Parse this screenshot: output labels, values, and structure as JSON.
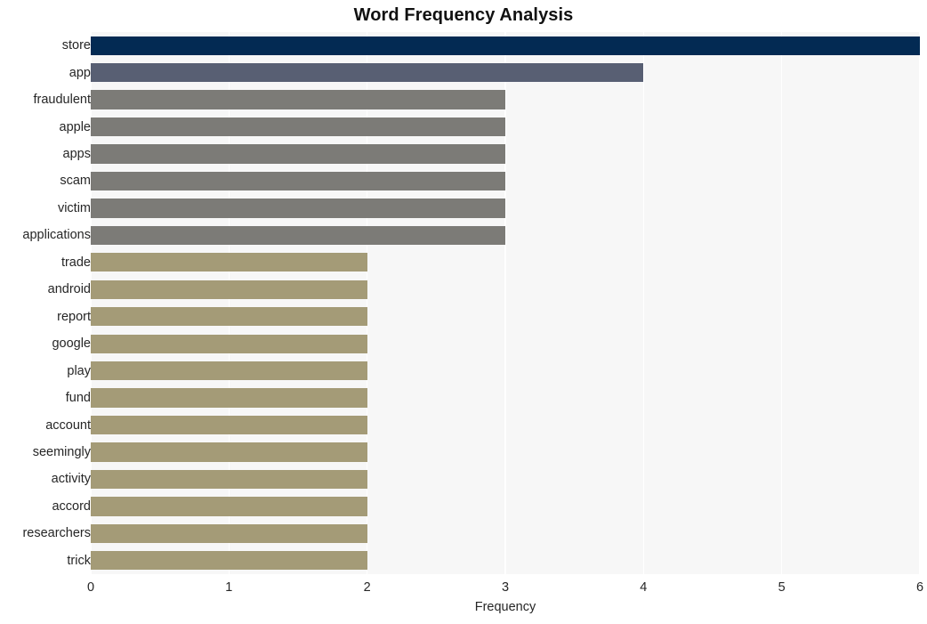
{
  "chart_data": {
    "type": "bar",
    "orientation": "horizontal",
    "title": "Word Frequency Analysis",
    "xlabel": "Frequency",
    "ylabel": "",
    "categories": [
      "store",
      "app",
      "fraudulent",
      "apple",
      "apps",
      "scam",
      "victim",
      "applications",
      "trade",
      "android",
      "report",
      "google",
      "play",
      "fund",
      "account",
      "seemingly",
      "activity",
      "accord",
      "researchers",
      "trick"
    ],
    "values": [
      6,
      4,
      3,
      3,
      3,
      3,
      3,
      3,
      2,
      2,
      2,
      2,
      2,
      2,
      2,
      2,
      2,
      2,
      2,
      2
    ],
    "bar_colors": [
      "#032a53",
      "#585f73",
      "#7c7b77",
      "#7c7b77",
      "#7c7b77",
      "#7c7b77",
      "#7c7b77",
      "#7c7b77",
      "#a49b77",
      "#a49b77",
      "#a49b77",
      "#a49b77",
      "#a49b77",
      "#a49b77",
      "#a49b77",
      "#a49b77",
      "#a49b77",
      "#a49b77",
      "#a49b77",
      "#a49b77"
    ],
    "xlim": [
      0,
      6
    ],
    "xticks": [
      0,
      1,
      2,
      3,
      4,
      5,
      6
    ],
    "xtick_labels": [
      "0",
      "1",
      "2",
      "3",
      "4",
      "5",
      "6"
    ],
    "grid": true,
    "grid_axis": "x",
    "grid_color": "#ffffff",
    "plot_background": "#f7f7f7",
    "figure_background": "#ffffff",
    "legend": null
  },
  "style": {
    "title_color": "#111111",
    "tick_label_color": "#262626"
  }
}
